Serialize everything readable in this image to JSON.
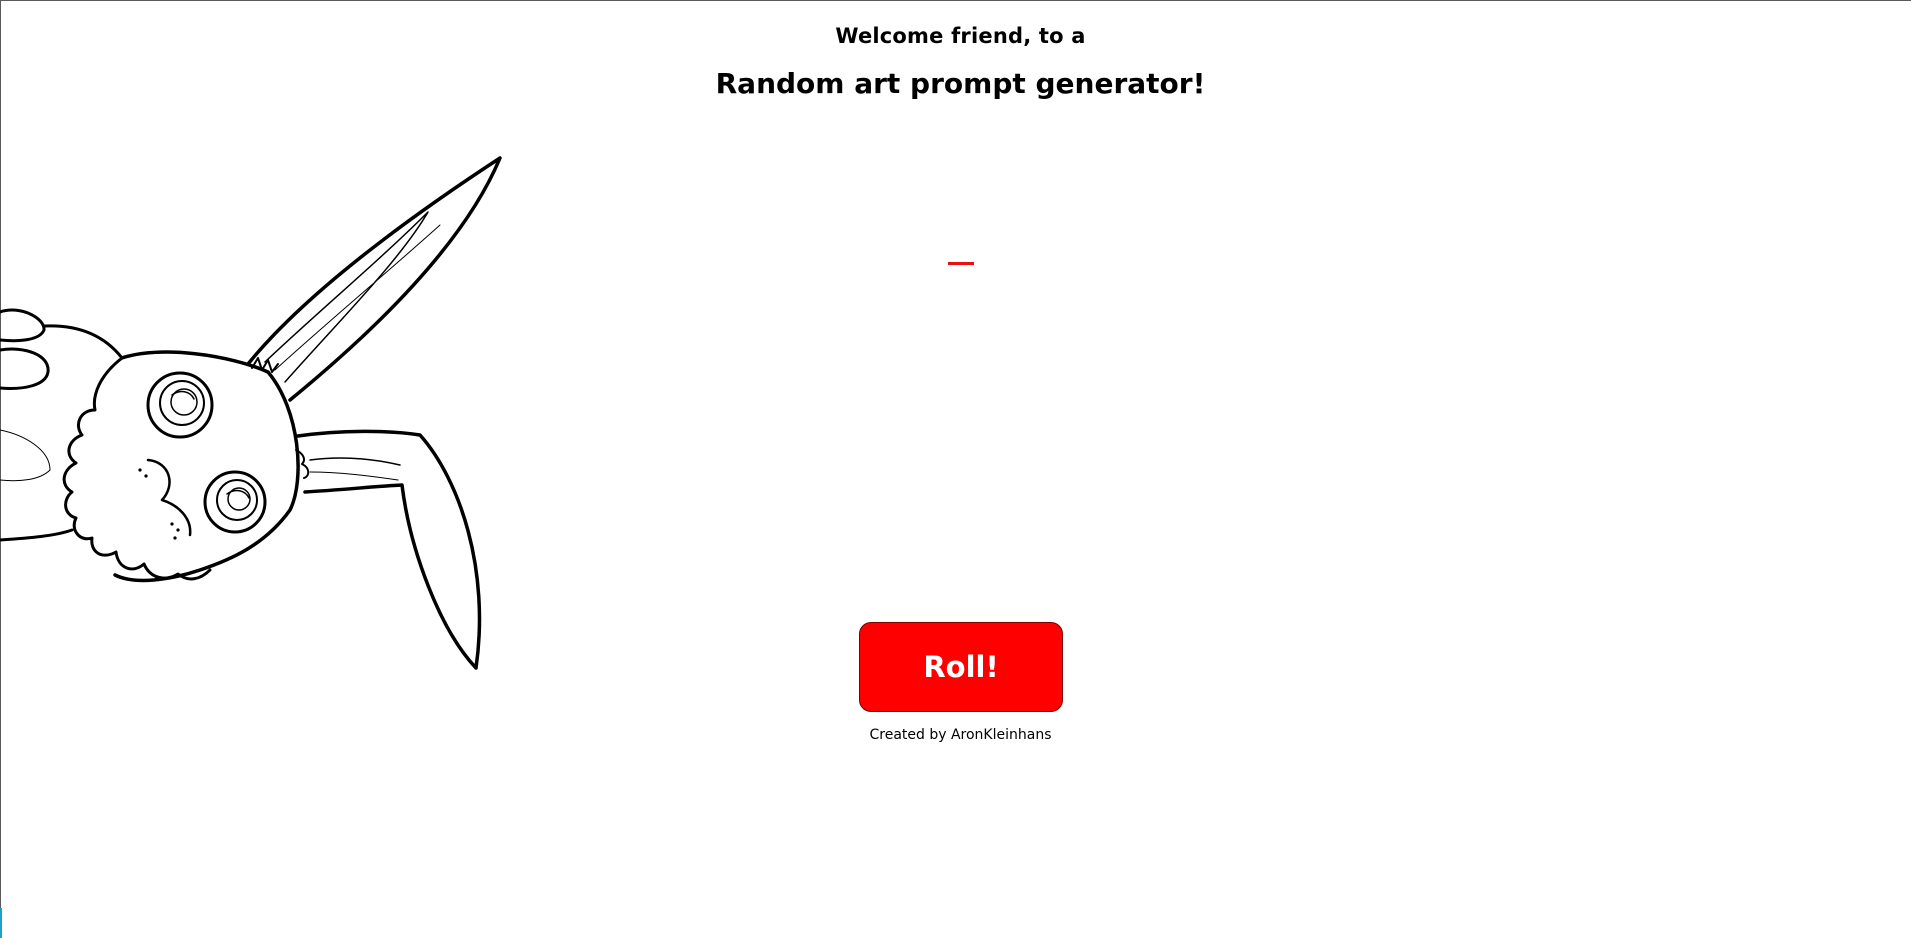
{
  "header": {
    "greeting": "Welcome friend, to a",
    "title": "Random art prompt generator!"
  },
  "prompt": {
    "text": ""
  },
  "actions": {
    "roll_label": "Roll!",
    "accent_color": "#ff0000"
  },
  "footer": {
    "credit": "Created by AronKleinhans"
  },
  "illustration": {
    "icon": "bunny-line-drawing"
  }
}
